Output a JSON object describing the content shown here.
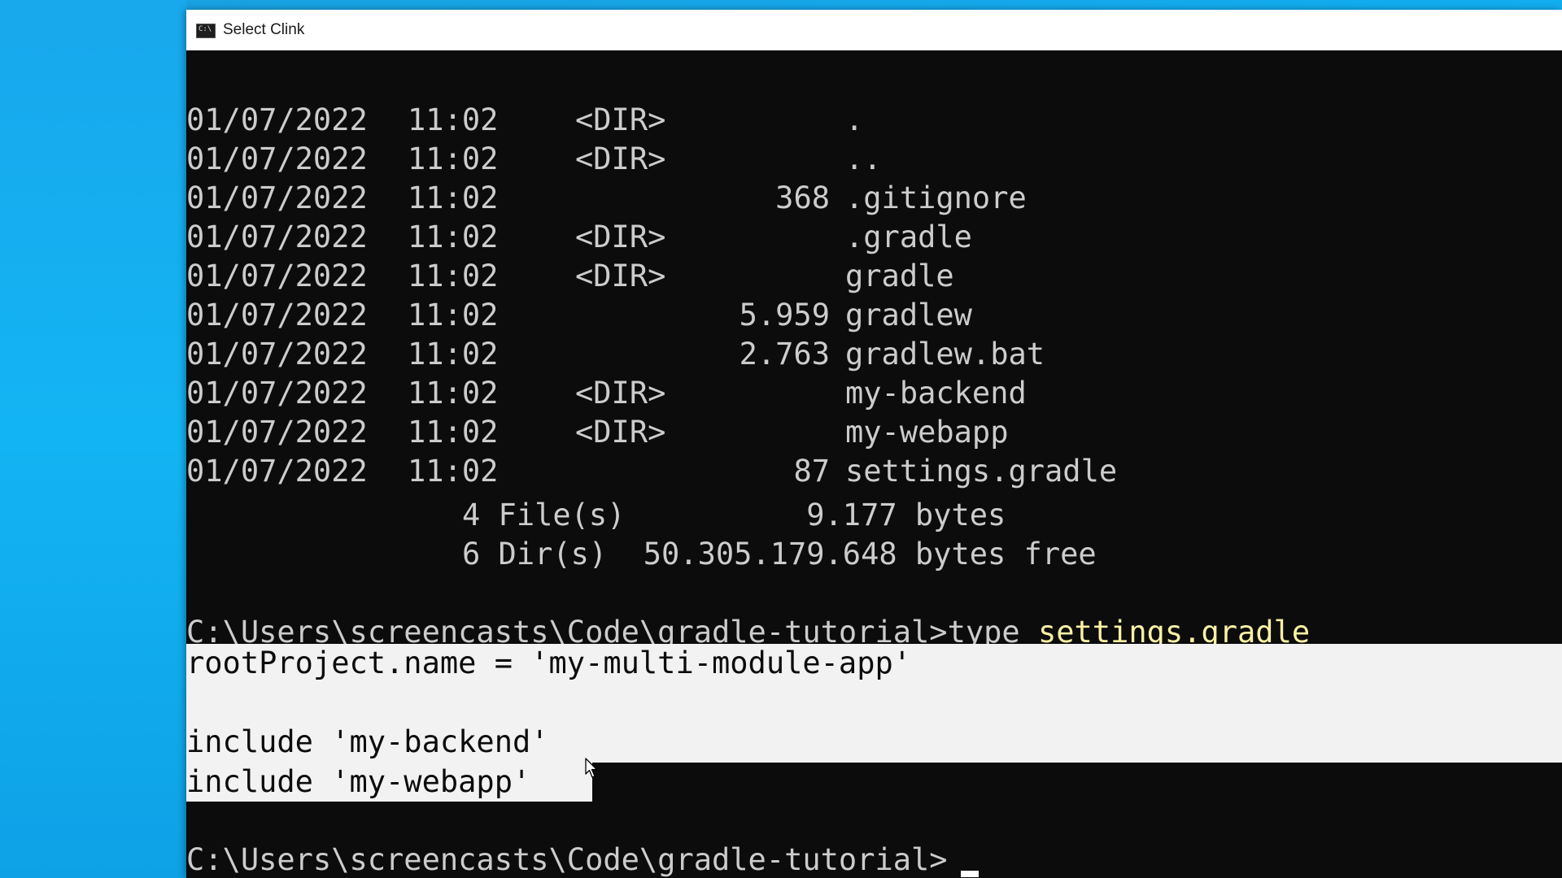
{
  "window": {
    "title": "Select Clink",
    "icon": "console-app-icon"
  },
  "console": {
    "dir_listing": [
      {
        "date": "01/07/2022",
        "time": "11:02",
        "type": "<DIR>",
        "size": "",
        "name": "."
      },
      {
        "date": "01/07/2022",
        "time": "11:02",
        "type": "<DIR>",
        "size": "",
        "name": ".."
      },
      {
        "date": "01/07/2022",
        "time": "11:02",
        "type": "",
        "size": "368",
        "name": ".gitignore"
      },
      {
        "date": "01/07/2022",
        "time": "11:02",
        "type": "<DIR>",
        "size": "",
        "name": ".gradle"
      },
      {
        "date": "01/07/2022",
        "time": "11:02",
        "type": "<DIR>",
        "size": "",
        "name": "gradle"
      },
      {
        "date": "01/07/2022",
        "time": "11:02",
        "type": "",
        "size": "5.959",
        "name": "gradlew"
      },
      {
        "date": "01/07/2022",
        "time": "11:02",
        "type": "",
        "size": "2.763",
        "name": "gradlew.bat"
      },
      {
        "date": "01/07/2022",
        "time": "11:02",
        "type": "<DIR>",
        "size": "",
        "name": "my-backend"
      },
      {
        "date": "01/07/2022",
        "time": "11:02",
        "type": "<DIR>",
        "size": "",
        "name": "my-webapp"
      },
      {
        "date": "01/07/2022",
        "time": "11:02",
        "type": "",
        "size": "87",
        "name": "settings.gradle"
      }
    ],
    "files_summary": "4 File(s)          9.177 bytes",
    "dirs_summary": "6 Dir(s)  50.305.179.648 bytes free",
    "prompt1": "C:\\Users\\screencasts\\Code\\gradle-tutorial>",
    "command": "type",
    "command_arg": "settings.gradle",
    "file_content": [
      "rootProject.name = 'my-multi-module-app'",
      "",
      "include 'my-backend'",
      "include 'my-webapp'"
    ],
    "prompt2": "C:\\Users\\screencasts\\Code\\gradle-tutorial>"
  },
  "colors": {
    "console_bg": "#0c0c0c",
    "console_text": "#cccccc",
    "command_arg": "#f9f1a5",
    "selection_bg": "#f2f2f2",
    "desktop": "#11aef0"
  }
}
